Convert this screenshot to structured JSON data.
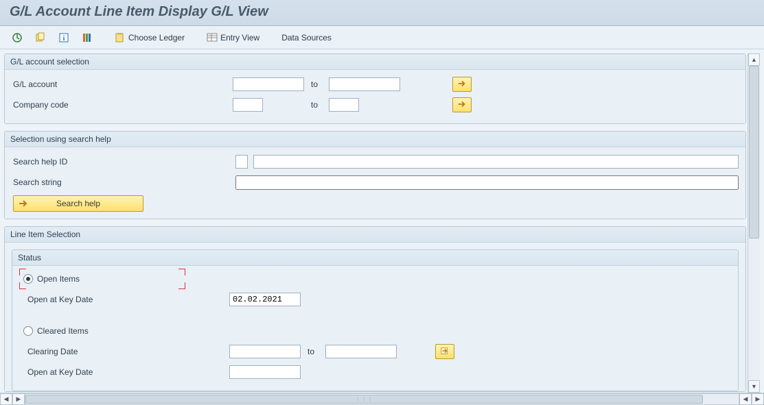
{
  "header": {
    "title": "G/L Account Line Item Display G/L View"
  },
  "toolbar": {
    "choose_ledger": "Choose Ledger",
    "entry_view": "Entry View",
    "data_sources": "Data Sources"
  },
  "gl_selection": {
    "title": "G/L account selection",
    "gl_account_label": "G/L account",
    "gl_account_from": "",
    "gl_account_to": "",
    "company_code_label": "Company code",
    "company_code_from": "",
    "company_code_to": "",
    "to_label": "to"
  },
  "search_help": {
    "title": "Selection using search help",
    "id_label": "Search help ID",
    "id_value": "",
    "id_desc": "",
    "string_label": "Search string",
    "string_value": "",
    "button_label": "Search help"
  },
  "line_item": {
    "title": "Line Item Selection",
    "status_title": "Status",
    "open_items_label": "Open Items",
    "open_key_date_label": "Open at Key Date",
    "open_key_date_value": "02.02.2021",
    "cleared_items_label": "Cleared Items",
    "clearing_date_label": "Clearing Date",
    "clearing_date_from": "",
    "clearing_date_to": "",
    "cleared_open_key_date_label": "Open at Key Date",
    "cleared_open_key_date_value": "",
    "to_label": "to"
  }
}
